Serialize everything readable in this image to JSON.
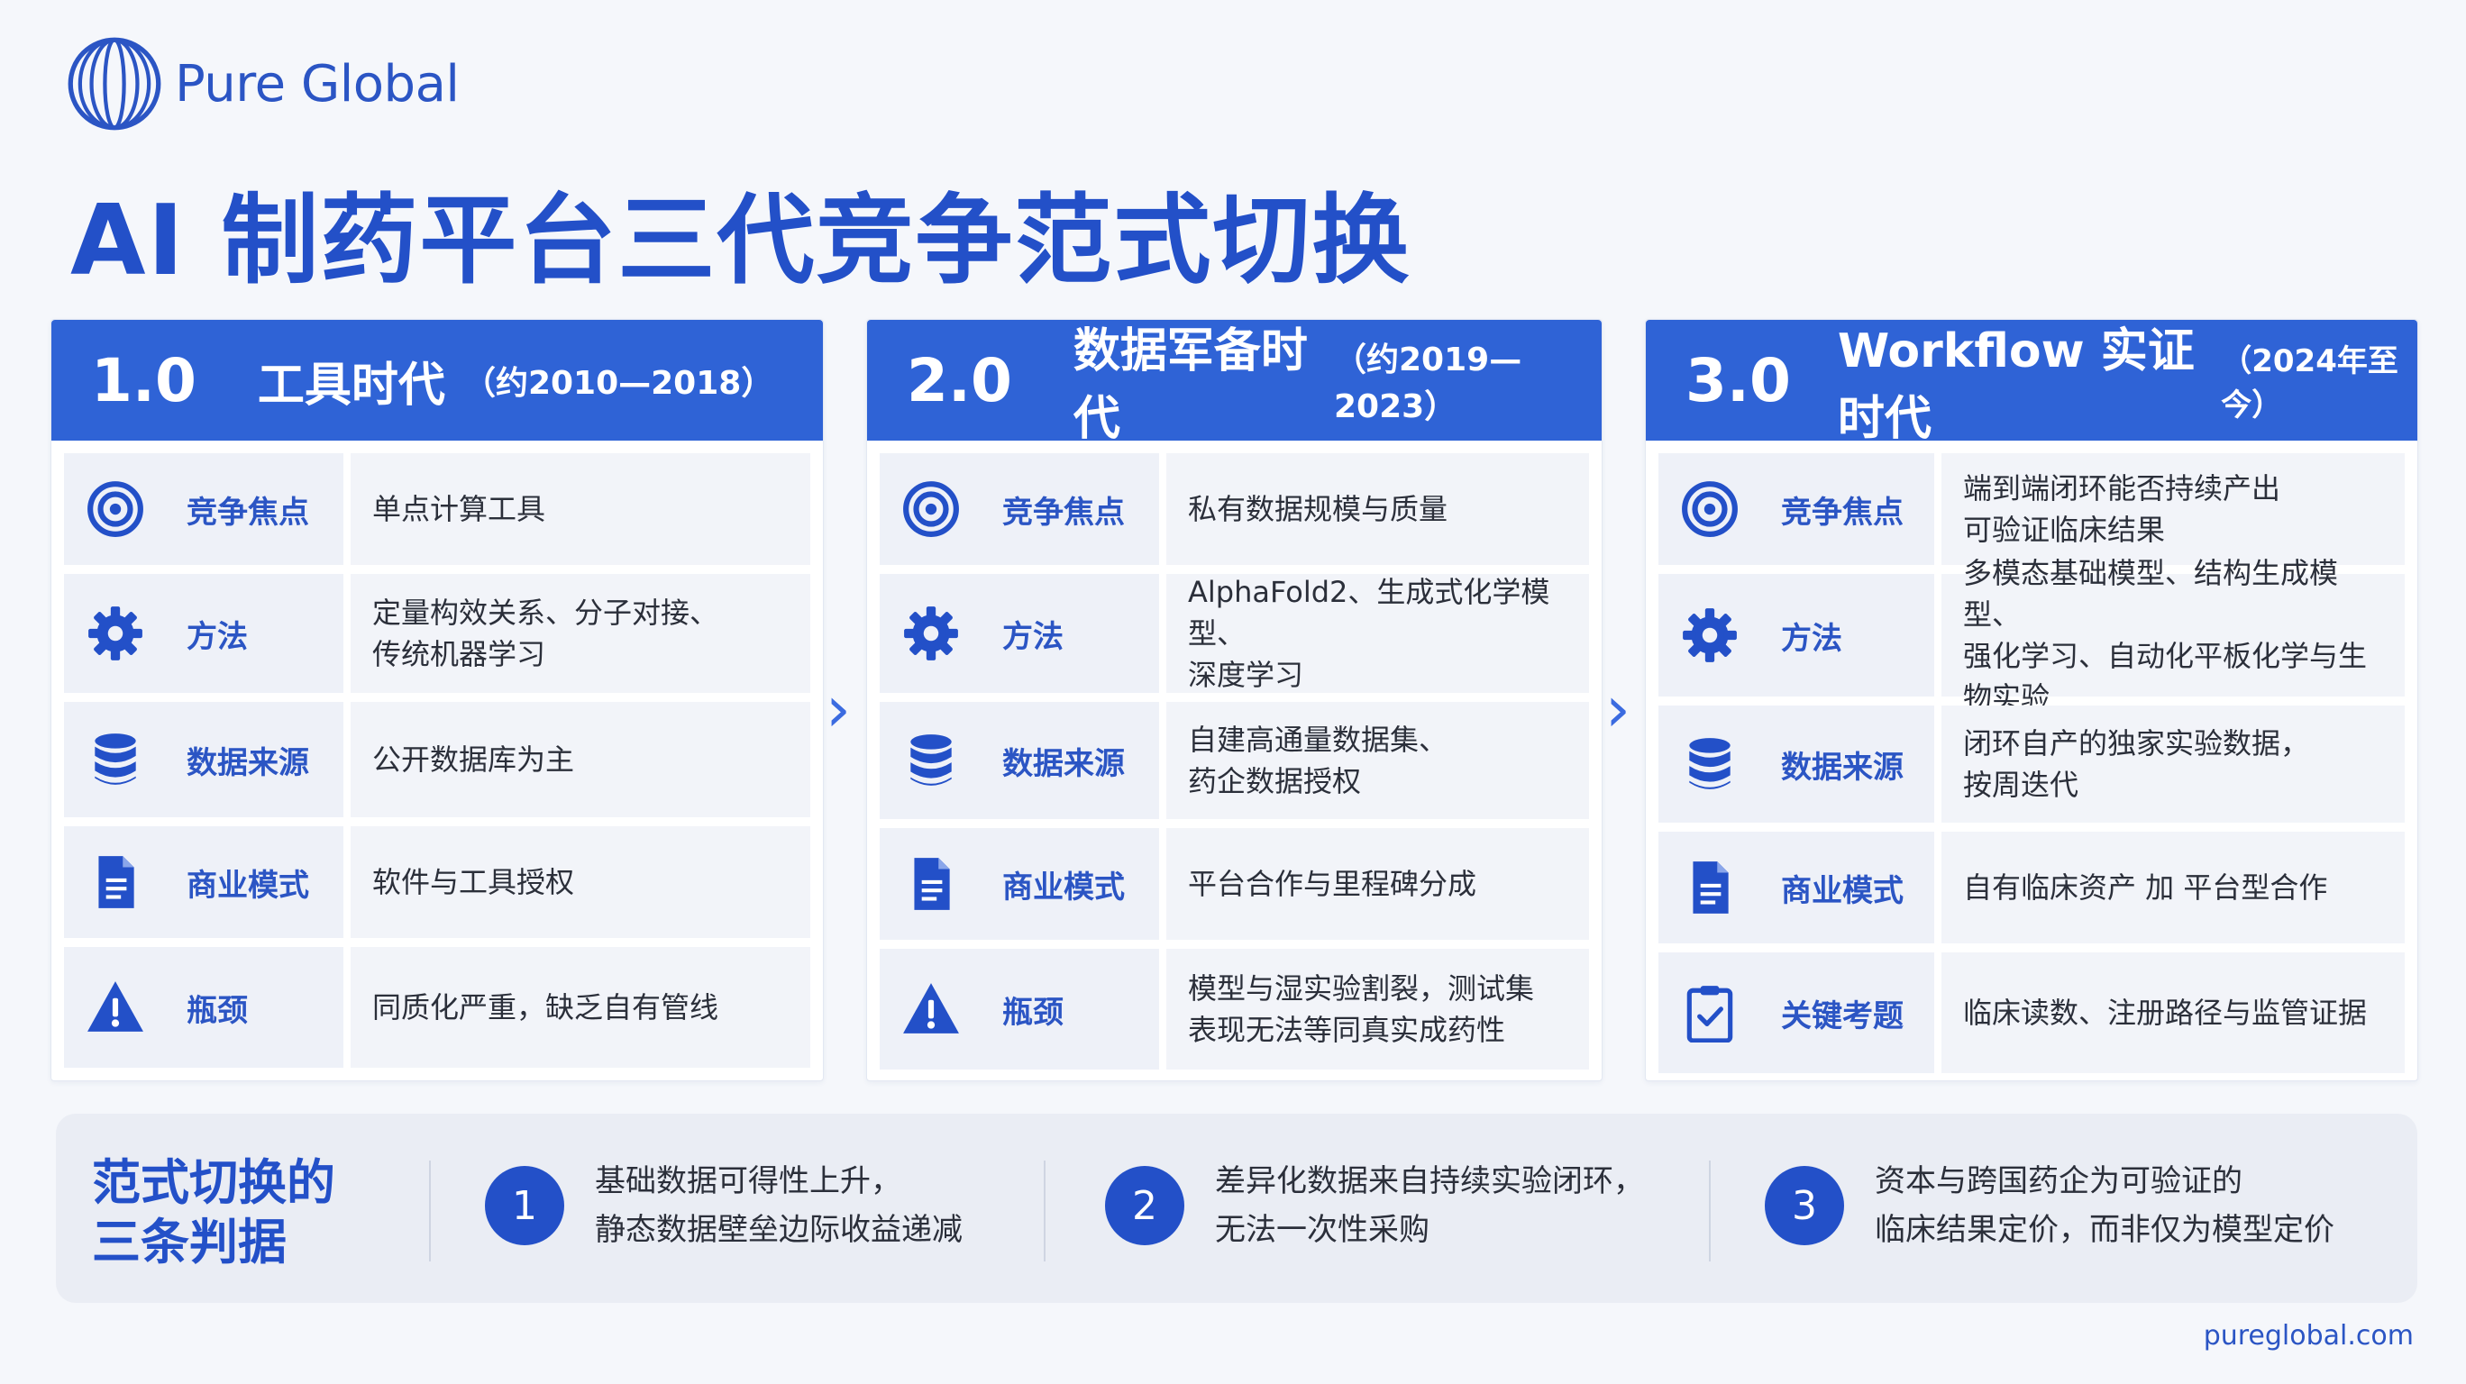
{
  "brand": {
    "name": "Pure Global"
  },
  "title": "AI 制药平台三代竞争范式切换",
  "colors": {
    "primary": "#2f63d6",
    "accent": "#2350c8",
    "row_bg": "#eef1f8"
  },
  "eras": [
    {
      "num": "1.0",
      "name": "工具时代",
      "period": "（约2010—2018）",
      "rows": [
        {
          "icon": "target-icon",
          "label": "竞争焦点",
          "value": "单点计算工具"
        },
        {
          "icon": "gear-icon",
          "label": "方法",
          "value": "定量构效关系、分子对接、\n传统机器学习"
        },
        {
          "icon": "database-icon",
          "label": "数据来源",
          "value": "公开数据库为主"
        },
        {
          "icon": "document-icon",
          "label": "商业模式",
          "value": "软件与工具授权"
        },
        {
          "icon": "warning-icon",
          "label": "瓶颈",
          "value": "同质化严重，缺乏自有管线"
        }
      ]
    },
    {
      "num": "2.0",
      "name": "数据军备时代",
      "period": "（约2019—2023）",
      "rows": [
        {
          "icon": "target-icon",
          "label": "竞争焦点",
          "value": "私有数据规模与质量"
        },
        {
          "icon": "gear-icon",
          "label": "方法",
          "value": "AlphaFold2、生成式化学模型、\n深度学习"
        },
        {
          "icon": "database-icon",
          "label": "数据来源",
          "value": "自建高通量数据集、\n药企数据授权"
        },
        {
          "icon": "document-icon",
          "label": "商业模式",
          "value": "平台合作与里程碑分成"
        },
        {
          "icon": "warning-icon",
          "label": "瓶颈",
          "value": "模型与湿实验割裂，测试集\n表现无法等同真实成药性"
        }
      ]
    },
    {
      "num": "3.0",
      "name": "Workflow 实证时代",
      "period": "（2024年至今）",
      "rows": [
        {
          "icon": "target-icon",
          "label": "竞争焦点",
          "value": "端到端闭环能否持续产出\n可验证临床结果"
        },
        {
          "icon": "gear-icon",
          "label": "方法",
          "value": "多模态基础模型、结构生成模型、\n强化学习、自动化平板化学与生物实验"
        },
        {
          "icon": "database-icon",
          "label": "数据来源",
          "value": "闭环自产的独家实验数据，\n按周迭代"
        },
        {
          "icon": "document-icon",
          "label": "商业模式",
          "value": "自有临床资产 加 平台型合作"
        },
        {
          "icon": "clipboard-check-icon",
          "label": "关键考题",
          "value": "临床读数、注册路径与监管证据"
        }
      ]
    }
  ],
  "bottom": {
    "title": "范式切换的\n三条判据",
    "criteria": [
      {
        "num": "1",
        "text": "基础数据可得性上升，\n静态数据壁垒边际收益递减"
      },
      {
        "num": "2",
        "text": "差异化数据来自持续实验闭环，\n无法一次性采购"
      },
      {
        "num": "3",
        "text": "资本与跨国药企为可验证的\n临床结果定价，而非仅为模型定价"
      }
    ]
  },
  "footer": {
    "url": "pureglobal.com"
  }
}
